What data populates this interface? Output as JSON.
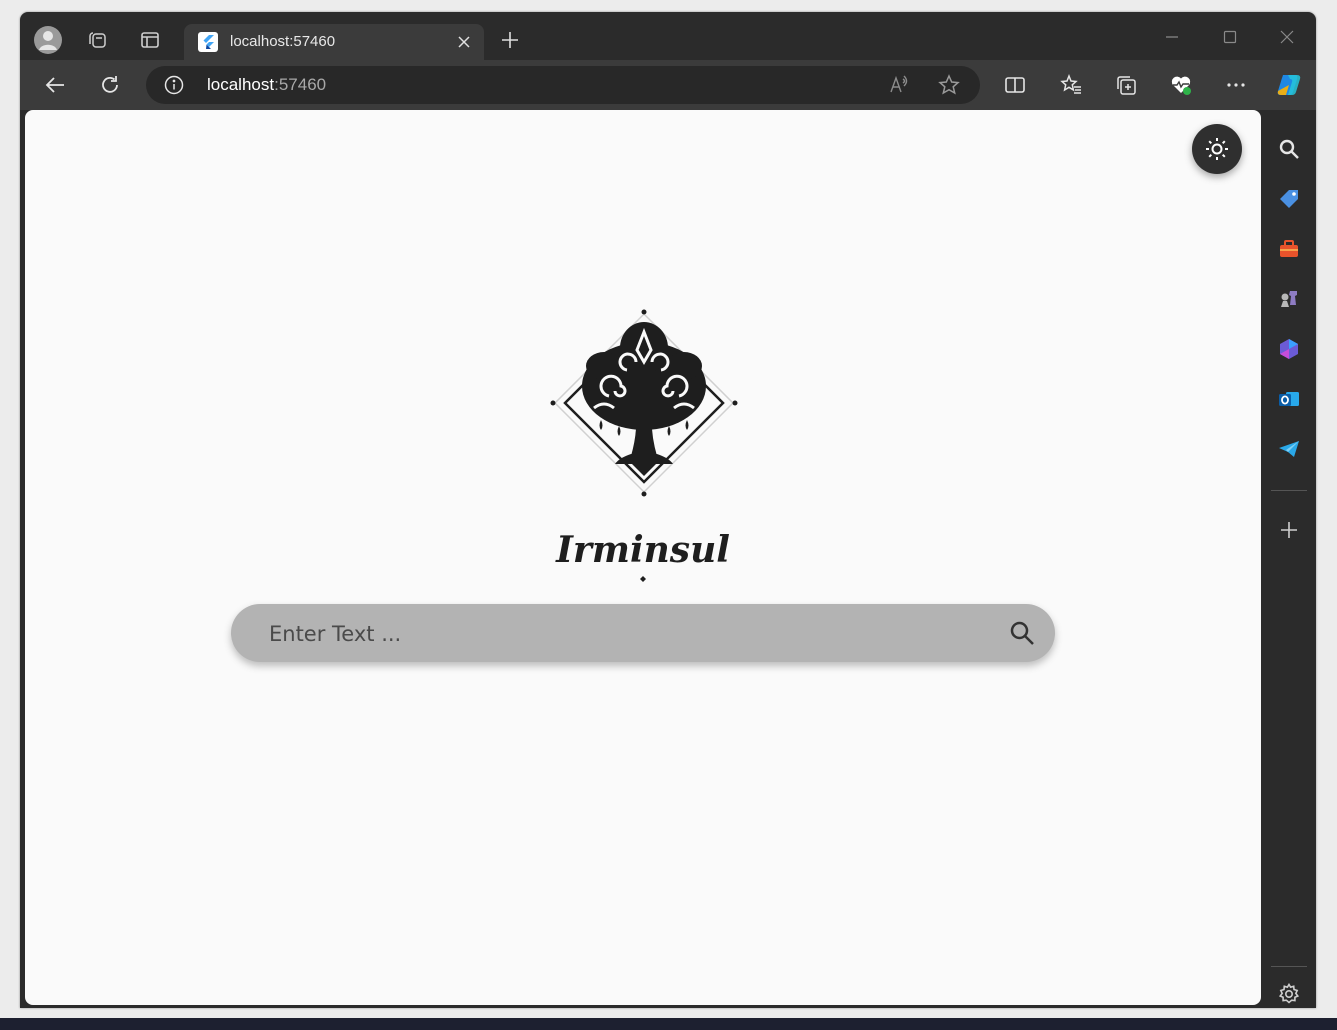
{
  "browser": {
    "tab": {
      "title": "localhost:57460"
    },
    "address": {
      "host": "localhost",
      "port": ":57460"
    }
  },
  "page": {
    "search": {
      "placeholder": "Enter Text ..."
    },
    "theme_toggle": {
      "icon": "sun-icon"
    },
    "logo": {
      "icon": "tree-logo"
    },
    "wordmark": {
      "text": "Irminsul"
    }
  },
  "sidebar": {
    "items": [
      {
        "icon": "search-icon"
      },
      {
        "icon": "shopping-tag-icon"
      },
      {
        "icon": "toolbox-icon"
      },
      {
        "icon": "chess-icon"
      },
      {
        "icon": "microsoft-365-icon"
      },
      {
        "icon": "outlook-icon"
      },
      {
        "icon": "telegram-icon"
      }
    ]
  },
  "colors": {
    "page_background": "#fafafa",
    "search_background": "#b3b3b3",
    "browser_chrome": "#3b3b3b",
    "logo": "#1e1e1e"
  }
}
